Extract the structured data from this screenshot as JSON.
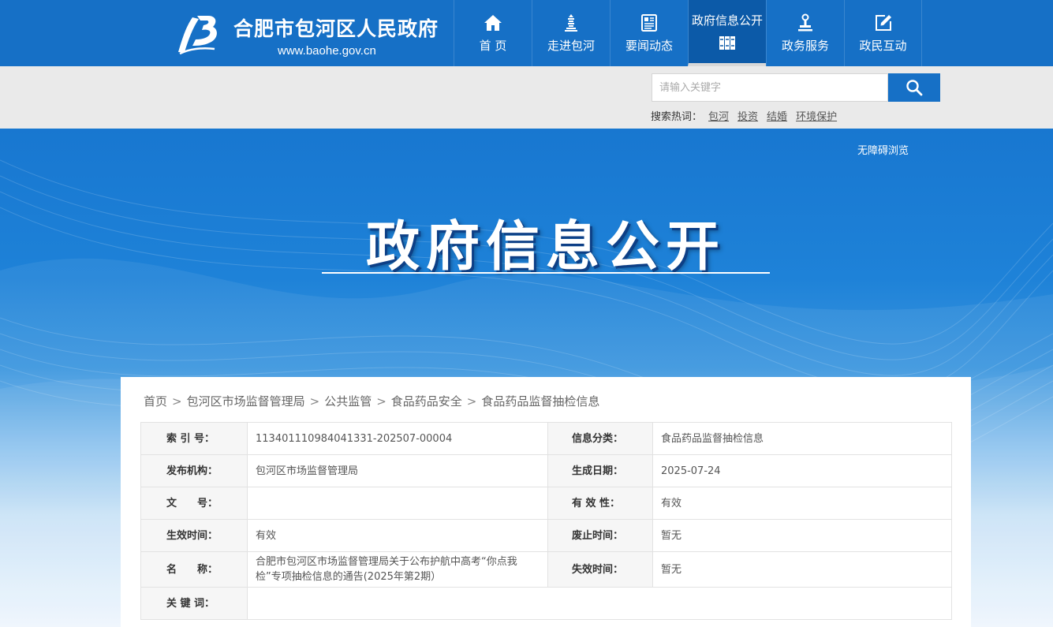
{
  "header": {
    "site_title": "合肥市包河区人民政府",
    "site_url": "www.baohe.gov.cn",
    "nav": [
      {
        "label": "首 页",
        "icon": "home-icon"
      },
      {
        "label": "走进包河",
        "icon": "tower-icon"
      },
      {
        "label": "要闻动态",
        "icon": "news-icon"
      },
      {
        "label": "政府信息公开",
        "icon": "books-icon",
        "active": true
      },
      {
        "label": "政务服务",
        "icon": "stamp-icon"
      },
      {
        "label": "政民互动",
        "icon": "edit-icon"
      }
    ]
  },
  "search": {
    "placeholder": "请输入关键字",
    "hot_label": "搜索热词：",
    "hot_words": [
      "包河",
      "投资",
      "结婚",
      "环境保护"
    ]
  },
  "banner": {
    "accessible_label": "无障碍浏览",
    "title": "政府信息公开"
  },
  "breadcrumb": [
    "首页",
    "包河区市场监督管理局",
    "公共监管",
    "食品药品安全",
    "食品药品监督抽检信息"
  ],
  "breadcrumb_sep": ">",
  "info": {
    "index_label": "索 引 号：",
    "index_value": "113401110984041331-202507-00004",
    "category_label": "信息分类：",
    "category_value": "食品药品监督抽检信息",
    "publisher_label": "发布机构：",
    "publisher_value": "包河区市场监督管理局",
    "date_label": "生成日期：",
    "date_value": "2025-07-24",
    "docno_label": "文　　号：",
    "docno_value": "",
    "validity_label": "有 效 性：",
    "validity_value": "有效",
    "effective_label": "生效时间：",
    "effective_value": "有效",
    "abolish_label": "废止时间：",
    "abolish_value": "暂无",
    "name_label": "名　　称：",
    "name_value": "合肥市包河区市场监督管理局关于公布护航中高考“你点我检”专项抽检信息的通告(2025年第2期）",
    "expire_label": "失效时间：",
    "expire_value": "暂无",
    "keywords_label": "关 键 词：",
    "keywords_value": ""
  },
  "colors": {
    "primary": "#1670c6",
    "active_nav": "#0c5aa8",
    "strip": "#eaeaea"
  }
}
